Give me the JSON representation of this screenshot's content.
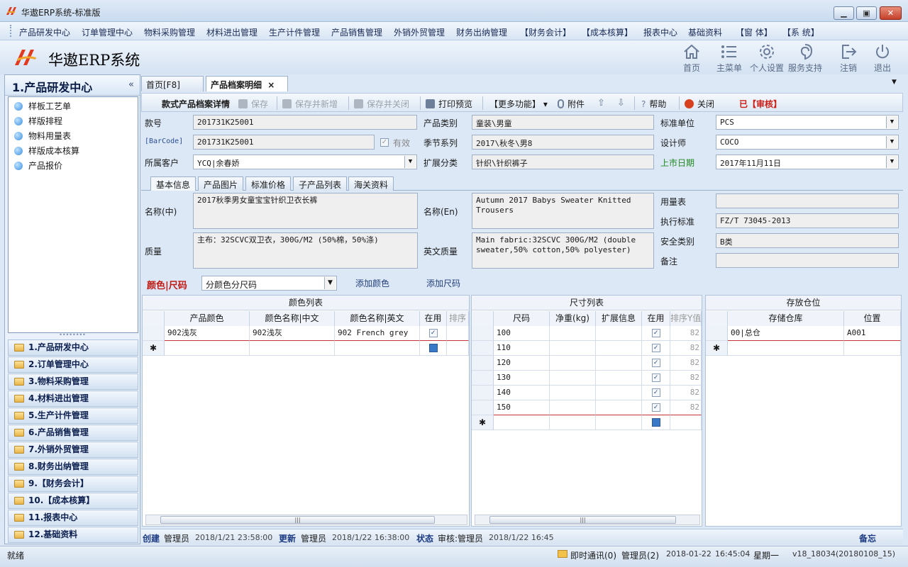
{
  "window": {
    "title": "华遨ERP系统-标准版",
    "min": "▁",
    "max": "▣",
    "close": "✕"
  },
  "menu": [
    "产品研发中心",
    "订单管理中心",
    "物料采购管理",
    "材料进出管理",
    "生产计件管理",
    "产品销售管理",
    "外销外贸管理",
    "财务出纳管理",
    "【财务会计】",
    "【成本核算】",
    "报表中心",
    "基础资料",
    "【窗 体】",
    "【系 统】"
  ],
  "brand": {
    "name": "华遨ERP系统"
  },
  "header_buttons": [
    {
      "label": "首页",
      "icon": "home-icon"
    },
    {
      "label": "主菜单",
      "icon": "menu-list-icon"
    },
    {
      "label": "个人设置",
      "icon": "gear-icon"
    },
    {
      "label": "服务支持",
      "icon": "support-icon"
    },
    {
      "label": "注销",
      "icon": "logout-icon"
    },
    {
      "label": "退出",
      "icon": "power-icon"
    }
  ],
  "sidebar": {
    "title": "1.产品研发中心",
    "collapse": "«",
    "items": [
      "样板工艺单",
      "样版排程",
      "物料用量表",
      "样版成本核算",
      "产品报价"
    ],
    "modules": [
      "1.产品研发中心",
      "2.订单管理中心",
      "3.物料采购管理",
      "4.材料进出管理",
      "5.生产计件管理",
      "6.产品销售管理",
      "7.外销外贸管理",
      "8.财务出纳管理",
      "9.【财务会计】",
      "10.【成本核算】",
      "11.报表中心",
      "12.基础资料"
    ]
  },
  "tabs": {
    "home": "首页[F8]",
    "detail": "产品档案明细",
    "close": "×",
    "dropdown": "▼"
  },
  "toolbar": {
    "title": "款式产品档案详情",
    "save": "保存",
    "save_new": "保存并新增",
    "save_close": "保存并关闭",
    "print": "打印预览",
    "more": "【更多功能】",
    "attach": "附件",
    "help": "帮助",
    "close": "关闭",
    "audited": "已【审核】",
    "more_arrow": "▾"
  },
  "form": {
    "style_no_label": "款号",
    "style_no": "201731K25001",
    "barcode_label": "[BarCode]",
    "barcode": "201731K25001",
    "valid_label": "有效",
    "customer_label": "所属客户",
    "customer": "YCQ|余春娇",
    "category_label": "产品类别",
    "category": "童装\\男童",
    "season_label": "季节系列",
    "season": "2017\\秋冬\\男8",
    "ext_label": "扩展分类",
    "ext": "针织\\针织裤子",
    "unit_label": "标准单位",
    "unit": "PCS",
    "designer_label": "设计师",
    "designer": "COCO",
    "launch_label": "上市日期",
    "launch": "2017年11月11日"
  },
  "subtabs": [
    "基本信息",
    "产品图片",
    "标准价格",
    "子产品列表",
    "海关资料"
  ],
  "basic": {
    "name_cn_label": "名称(中)",
    "name_cn": "2017秋季男女童宝宝针织卫衣长裤",
    "name_en_label": "名称(En)",
    "name_en": "Autumn 2017 Babys Sweater Knitted Trousers",
    "quality_label": "质量",
    "quality": "主布：32SCVC双卫衣，300G/M2 (50%棉，50%涤)",
    "quality_en_label": "英文质量",
    "quality_en": "Main fabric:32SCVC 300G/M2 (double sweater,50% cotton,50% polyester)",
    "usage_label": "用量表",
    "usage": "",
    "standard_label": "执行标准",
    "standard": "FZ/T 73045-2013",
    "safety_label": "安全类别",
    "safety": "B类",
    "remark_label": "备注",
    "remark": ""
  },
  "color_size": {
    "label": "颜色|尺码",
    "mode": "分颜色分尺码",
    "add_color": "添加颜色",
    "add_size": "添加尺码"
  },
  "color_grid": {
    "title": "颜色列表",
    "columns": [
      "产品颜色",
      "颜色名称|中文",
      "颜色名称|英文",
      "在用",
      "排序"
    ],
    "rows": [
      [
        "902浅灰",
        "902浅灰",
        "902 French grey"
      ]
    ],
    "new_row": "✱"
  },
  "size_grid": {
    "title": "尺寸列表",
    "columns": [
      "尺码",
      "净重(kg)",
      "扩展信息",
      "在用",
      "排序Y值"
    ],
    "rows": [
      [
        "100",
        "82"
      ],
      [
        "110",
        "82"
      ],
      [
        "120",
        "82"
      ],
      [
        "130",
        "82"
      ],
      [
        "140",
        "82"
      ],
      [
        "150",
        "82"
      ]
    ],
    "new_row": "✱"
  },
  "warehouse_grid": {
    "title": "存放仓位",
    "columns": [
      "存储仓库",
      "位置"
    ],
    "rows": [
      [
        "00|总仓",
        "A001"
      ]
    ],
    "new_row": "✱"
  },
  "infobar": {
    "created_label": "创建",
    "created_by": "管理员",
    "created_at": "2018/1/21 23:58:00",
    "updated_label": "更新",
    "updated_by": "管理员",
    "updated_at": "2018/1/22 16:38:00",
    "state_label": "状态",
    "state": "审核:管理员",
    "state_at": "2018/1/22 16:45",
    "memo": "备忘"
  },
  "status": {
    "left": "就绪",
    "im": "即时通讯(0)",
    "user": "管理员(2)",
    "date": "2018-01-22",
    "time": "16:45:04",
    "weekday": "星期一",
    "version": "v18_18034(20180108_15)"
  }
}
